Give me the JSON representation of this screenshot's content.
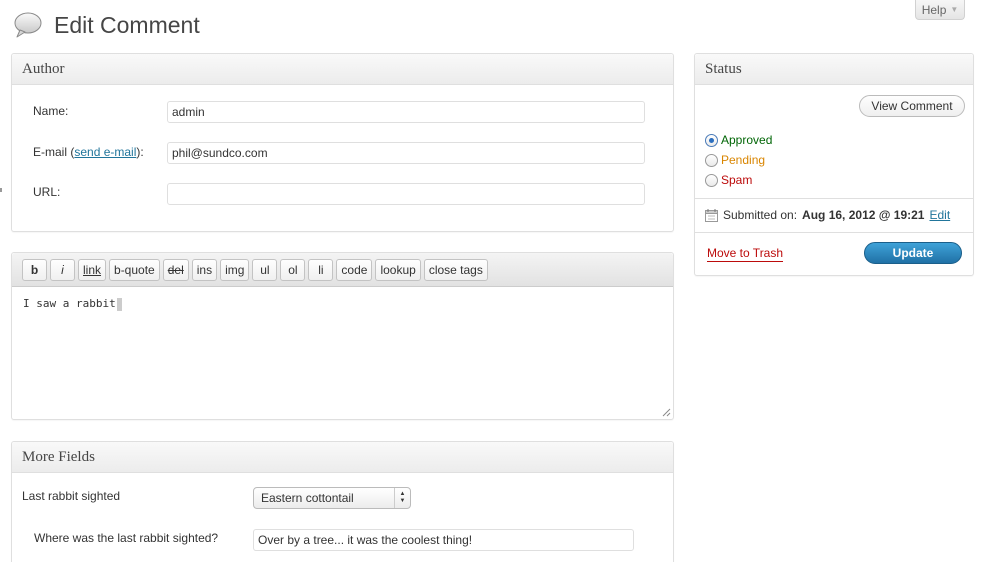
{
  "page": {
    "title": "Edit Comment",
    "help_label": "Help"
  },
  "author": {
    "heading": "Author",
    "name_label": "Name:",
    "name_value": "admin",
    "email_label_prefix": "E-mail (",
    "email_link": "send e-mail",
    "email_label_suffix": "):",
    "email_value": "phil@sundco.com",
    "url_label": "URL:",
    "url_value": ""
  },
  "editor": {
    "buttons": [
      "b",
      "i",
      "link",
      "b-quote",
      "del",
      "ins",
      "img",
      "ul",
      "ol",
      "li",
      "code",
      "lookup",
      "close tags"
    ],
    "content": "I saw a rabbit"
  },
  "more_fields": {
    "heading": "More Fields",
    "last_sighted_label": "Last rabbit sighted",
    "last_sighted_value": "Eastern cottontail",
    "where_label": "Where was the last rabbit sighted?",
    "where_value": "Over by a tree... it was the coolest thing!"
  },
  "status": {
    "heading": "Status",
    "view_button": "View Comment",
    "options": [
      {
        "label": "Approved",
        "color": "#006505",
        "checked": true
      },
      {
        "label": "Pending",
        "color": "#d98500",
        "checked": false
      },
      {
        "label": "Spam",
        "color": "#bc0b0b",
        "checked": false
      }
    ],
    "submitted_prefix": "Submitted on:",
    "submitted_date": "Aug 16, 2012 @ 19:21",
    "edit_link": "Edit",
    "trash_link": "Move to Trash",
    "update_button": "Update"
  },
  "colors": {
    "link": "#21759b",
    "update_button": "#2a7fb8",
    "trash": "#bc0b0b"
  }
}
